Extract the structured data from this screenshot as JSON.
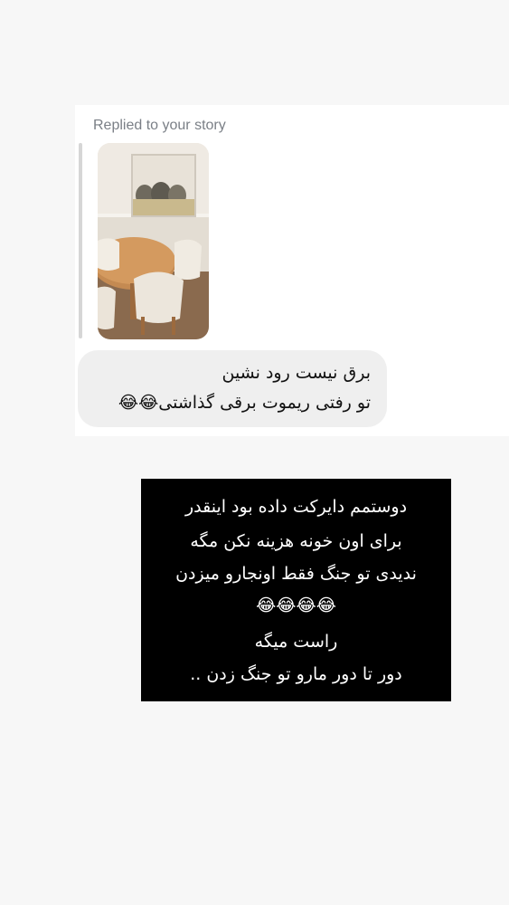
{
  "dm": {
    "replied_label": "Replied to your story",
    "story_image_alt": "story-photo-dining-room",
    "message_lines": [
      "برق نیست رود نشین",
      "تو رفتی ریموت برقی گذاشتی😂😂"
    ]
  },
  "caption": {
    "lines": [
      "دوستمم دایرکت داده بود اینقدر",
      "برای اون خونه هزینه نکن مگه",
      "ندیدی تو جنگ فقط اونجارو میزدن",
      "😂😂😂😂",
      "راست میگه",
      "دور تا دور مارو تو جنگ زدن .."
    ]
  },
  "colors": {
    "page_bg": "#f7f7f7",
    "card_bg": "#ffffff",
    "bubble_bg": "#efefef",
    "caption_bg": "#000000",
    "caption_text": "#ffffff",
    "replied_text": "#7a7f86"
  }
}
